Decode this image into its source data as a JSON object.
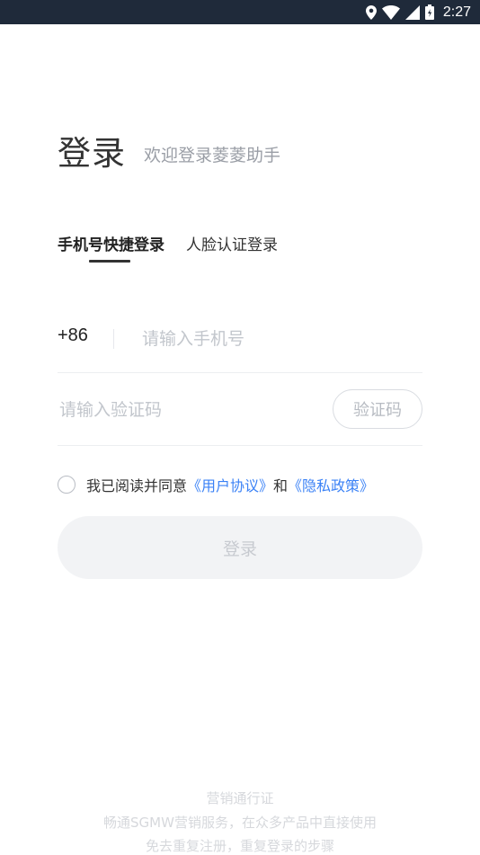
{
  "status_bar": {
    "time": "2:27",
    "icons": [
      "location-icon",
      "wifi-icon",
      "signal-icon",
      "battery-icon"
    ]
  },
  "header": {
    "title": "登录",
    "subtitle": "欢迎登录菱菱助手"
  },
  "tabs": [
    {
      "label": "手机号快捷登录",
      "active": true
    },
    {
      "label": "人脸认证登录",
      "active": false
    }
  ],
  "phone": {
    "country_code": "+86",
    "placeholder": "请输入手机号"
  },
  "verification": {
    "placeholder": "请输入验证码",
    "button_label": "验证码"
  },
  "agreement": {
    "prefix": "我已阅读并同意",
    "user_agreement": "《用户协议》",
    "conjunction": "和",
    "privacy_policy": "《隐私政策》",
    "checked": false
  },
  "login_button": {
    "label": "登录"
  },
  "footer": {
    "title": "营销通行证",
    "line1": "畅通SGMW营销服务，在众多产品中直接使用",
    "line2": "免去重复注册，重复登录的步骤"
  },
  "colors": {
    "status_bar": "#1f2a3a",
    "link": "#3b82f6",
    "button_disabled": "#f2f3f5"
  }
}
